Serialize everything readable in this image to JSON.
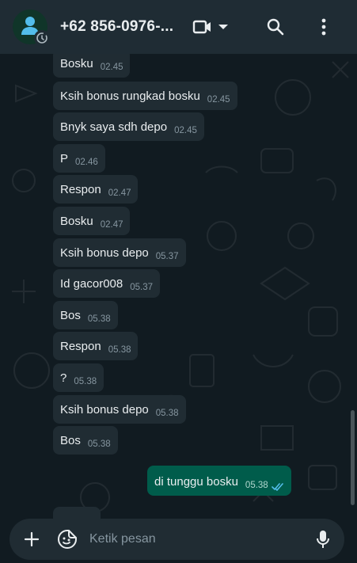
{
  "header": {
    "contact_name": "+62 856-0976-...",
    "icons": [
      "person-icon",
      "status-clock-icon",
      "video-call-icon",
      "dropdown-arrow-icon",
      "search-icon",
      "more-options-icon"
    ]
  },
  "messages": [
    {
      "text": "Bosku",
      "time": "02.45",
      "direction": "in"
    },
    {
      "text": "Ksih bonus rungkad bosku",
      "time": "02.45",
      "direction": "in"
    },
    {
      "text": "Bnyk saya sdh depo",
      "time": "02.45",
      "direction": "in"
    },
    {
      "text": "P",
      "time": "02.46",
      "direction": "in"
    },
    {
      "text": "Respon",
      "time": "02.47",
      "direction": "in"
    },
    {
      "text": "Bosku",
      "time": "02.47",
      "direction": "in"
    },
    {
      "text": "Ksih bonus depo",
      "time": "05.37",
      "direction": "in"
    },
    {
      "text": "Id gacor008",
      "time": "05.37",
      "direction": "in"
    },
    {
      "text": "Bos",
      "time": "05.38",
      "direction": "in"
    },
    {
      "text": "Respon",
      "time": "05.38",
      "direction": "in"
    },
    {
      "text": "?",
      "time": "05.38",
      "direction": "in"
    },
    {
      "text": "Ksih bonus depo",
      "time": "05.38",
      "direction": "in"
    },
    {
      "text": "Bos",
      "time": "05.38",
      "direction": "in"
    },
    {
      "text": "di tunggu bosku",
      "time": "05.38",
      "direction": "out",
      "status": "read"
    }
  ],
  "composer": {
    "placeholder": "Ketik pesan"
  },
  "colors": {
    "header_bg": "#1f2c34",
    "chat_bg": "#111b21",
    "incoming_bubble": "#202c33",
    "outgoing_bubble": "#005c4b",
    "read_ticks": "#53bdeb",
    "secondary_text": "#8696a0"
  }
}
